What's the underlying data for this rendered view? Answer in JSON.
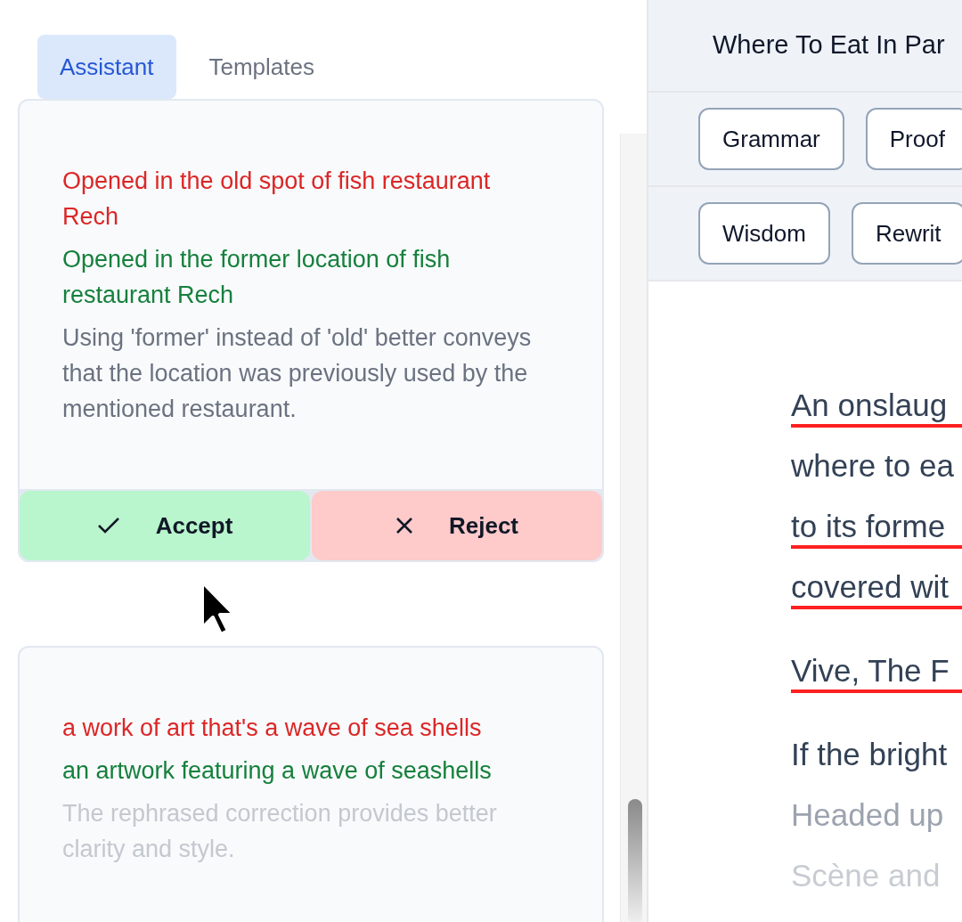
{
  "sidebar": {
    "tabs": [
      {
        "label": "Assistant",
        "selected": true
      },
      {
        "label": "Templates",
        "selected": false
      }
    ],
    "suggestions": [
      {
        "original": "Opened in the old spot of fish restaurant Rech",
        "replacement": "Opened in the former location of fish restaurant Rech",
        "explanation": "Using 'former' instead of 'old' better conveys that the location was previously used by the mentioned restaurant.",
        "faded": false,
        "actions": [
          {
            "kind": "accept",
            "label": "Accept"
          },
          {
            "kind": "reject",
            "label": "Reject"
          }
        ]
      },
      {
        "original": "a work of art that's a wave of sea shells",
        "replacement": "an artwork featuring a wave of seashells",
        "explanation": "The rephrased correction provides better clarity and style.",
        "faded": true
      }
    ]
  },
  "editor": {
    "title": "Where To Eat In Par",
    "toolbar_rows": [
      [
        "Grammar",
        "Proof"
      ],
      [
        "Wisdom",
        "Rewrit"
      ]
    ],
    "paragraphs": [
      {
        "lines": [
          {
            "text": "An onslaug",
            "underlined": true,
            "kind": "normal"
          },
          {
            "text": "where to ea",
            "underlined": false,
            "kind": "normal"
          },
          {
            "text": "to its forme",
            "underlined": true,
            "kind": "normal"
          },
          {
            "text": "covered wit",
            "underlined": true,
            "kind": "normal"
          }
        ]
      },
      {
        "lines": [
          {
            "text": "Vive, The F",
            "underlined": true,
            "kind": "normal"
          }
        ]
      },
      {
        "lines": [
          {
            "text": "If the bright",
            "underlined": false,
            "kind": "normal"
          },
          {
            "text": "Headed up",
            "underlined": false,
            "kind": "muted"
          },
          {
            "text": "Scène and",
            "underlined": false,
            "kind": "faint"
          }
        ]
      }
    ]
  }
}
